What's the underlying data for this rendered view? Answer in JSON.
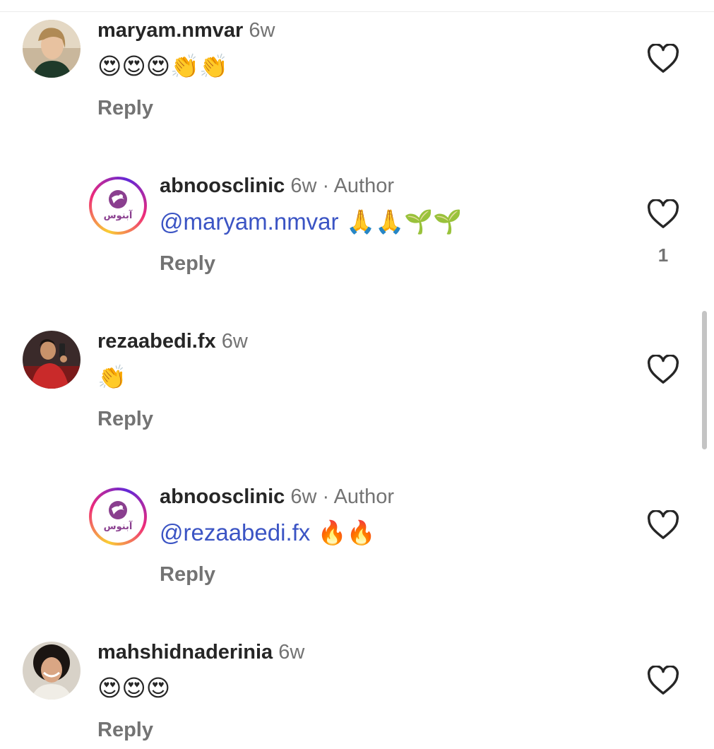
{
  "comments": [
    {
      "username": "maryam.nmvar",
      "time": "6w",
      "author_tag": "",
      "mention": "",
      "emojis": "😍😍😍👏👏",
      "reply_label": "Reply",
      "like_count": "",
      "avatar_icon": "profile-photo-woman"
    },
    {
      "username": "abnoosclinic",
      "time": "6w",
      "author_tag": "· Author",
      "mention": "@maryam.nmvar",
      "emojis": " 🙏🙏🌱🌱",
      "reply_label": "Reply",
      "like_count": "1",
      "avatar_icon": "abnoos-clinic-logo",
      "logo_text": "آبنوس"
    },
    {
      "username": "rezaabedi.fx",
      "time": "6w",
      "author_tag": "",
      "mention": "",
      "emojis": "👏",
      "reply_label": "Reply",
      "like_count": "",
      "avatar_icon": "profile-photo-man-red-shirt"
    },
    {
      "username": "abnoosclinic",
      "time": "6w",
      "author_tag": "· Author",
      "mention": "@rezaabedi.fx",
      "emojis": " 🔥🔥",
      "reply_label": "Reply",
      "like_count": "",
      "avatar_icon": "abnoos-clinic-logo",
      "logo_text": "آبنوس"
    },
    {
      "username": "mahshidnaderinia",
      "time": "6w",
      "author_tag": "",
      "mention": "",
      "emojis": "😍😍😍",
      "reply_label": "Reply",
      "like_count": "",
      "avatar_icon": "profile-photo-woman-curly-hair"
    }
  ],
  "colors": {
    "username": "#262626",
    "secondary_text": "#737373",
    "mention": "#3b54c4",
    "divider": "#ececec",
    "scrollbar": "#c4c4c4"
  }
}
